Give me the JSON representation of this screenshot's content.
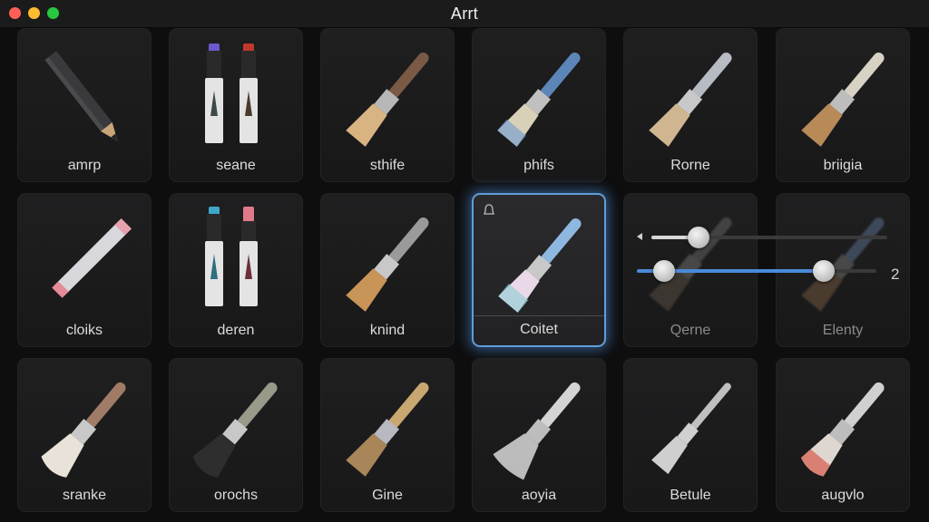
{
  "window": {
    "title": "Arrt"
  },
  "tiles": [
    {
      "label": "amrp",
      "tool": "pencil-dark"
    },
    {
      "label": "seane",
      "tool": "markers-purple-red"
    },
    {
      "label": "sthife",
      "tool": "brush-brown"
    },
    {
      "label": "phifs",
      "tool": "brush-blue"
    },
    {
      "label": "Rorne",
      "tool": "brush-grey-blue"
    },
    {
      "label": "briigia",
      "tool": "brush-cream"
    },
    {
      "label": "cloiks",
      "tool": "pencil-light"
    },
    {
      "label": "deren",
      "tool": "markers-teal-pink"
    },
    {
      "label": "knind",
      "tool": "brush-tan"
    },
    {
      "label": "Coitet",
      "tool": "brush-pastel",
      "selected": true
    },
    {
      "label": "Qerne",
      "tool": "brush-faded"
    },
    {
      "label": "Elenty",
      "tool": "brush-faded-blue"
    },
    {
      "label": "sranke",
      "tool": "brush-soft-tan"
    },
    {
      "label": "orochs",
      "tool": "brush-dark-bristle"
    },
    {
      "label": "Gine",
      "tool": "brush-stiff"
    },
    {
      "label": "aoyia",
      "tool": "brush-fan-white"
    },
    {
      "label": "Betule",
      "tool": "brush-thin"
    },
    {
      "label": "augvlo",
      "tool": "brush-red-tip"
    }
  ],
  "sliders": [
    {
      "name": "size",
      "value_fraction": 0.2,
      "accent": "#d8d8d8"
    },
    {
      "name": "opacity",
      "value_fraction": 0.78,
      "accent": "#4a8ad8",
      "value_label": "2"
    }
  ],
  "colors": {
    "accent": "#5f9edb",
    "background": "#0e0e0f"
  }
}
